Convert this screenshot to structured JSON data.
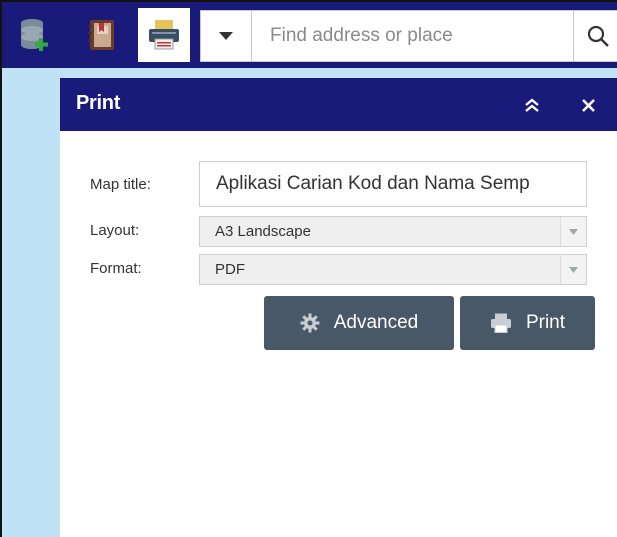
{
  "toolbar": {
    "tools": [
      {
        "name": "add-data-icon"
      },
      {
        "name": "bookmark-icon"
      },
      {
        "name": "print-icon",
        "active": true
      }
    ],
    "search": {
      "placeholder": "Find address or place",
      "value": ""
    }
  },
  "print_panel": {
    "title": "Print",
    "fields": {
      "map_title": {
        "label": "Map title:",
        "value": "Aplikasi Carian Kod dan Nama Semp"
      },
      "layout": {
        "label": "Layout:",
        "value": "A3 Landscape"
      },
      "format": {
        "label": "Format:",
        "value": "PDF"
      }
    },
    "buttons": {
      "advanced": "Advanced",
      "print": "Print"
    }
  },
  "colors": {
    "header": "#1a1a7a",
    "button": "#485867",
    "map": "#bfe3f4"
  }
}
